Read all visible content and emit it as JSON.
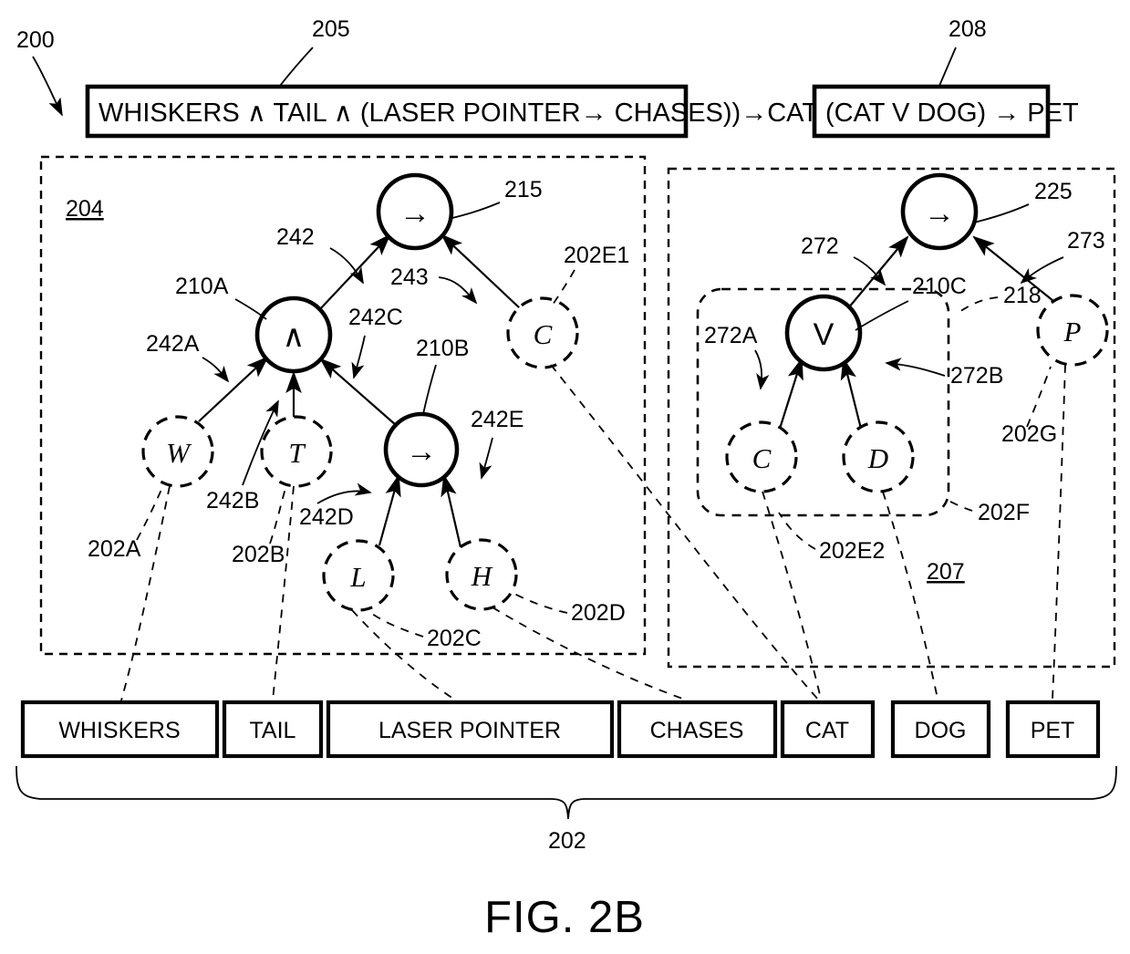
{
  "figure": {
    "caption": "FIG. 2B",
    "root_ref": "200",
    "bottom_brace_ref": "202"
  },
  "formulas": [
    {
      "id": "formula-left",
      "ref": "205",
      "text": "WHISKERS ∧ TAIL ∧ (LASER POINTER→ CHASES))→CAT"
    },
    {
      "id": "formula-right",
      "ref": "208",
      "text": "(CAT V DOG)  →  PET"
    }
  ],
  "panels": [
    {
      "id": "panel-left",
      "ref": "204"
    },
    {
      "id": "panel-right",
      "ref": "207"
    }
  ],
  "group_box": {
    "id": "group-202F",
    "ref": "202F",
    "inner_ref": "218"
  },
  "left_tree": {
    "nodes": [
      {
        "id": "n-215",
        "glyph": "→",
        "style": "solid",
        "ref": "215"
      },
      {
        "id": "n-210A",
        "glyph": "∧",
        "style": "solid",
        "ref": "210A"
      },
      {
        "id": "n-210B",
        "glyph": "→",
        "style": "solid",
        "ref": "210B"
      },
      {
        "id": "n-W",
        "glyph": "W",
        "style": "dashed",
        "ref": "202A"
      },
      {
        "id": "n-T",
        "glyph": "T",
        "style": "dashed",
        "ref": "202B"
      },
      {
        "id": "n-L",
        "glyph": "L",
        "style": "dashed",
        "ref": "202C"
      },
      {
        "id": "n-H",
        "glyph": "H",
        "style": "dashed",
        "ref": "202D"
      },
      {
        "id": "n-C1",
        "glyph": "C",
        "style": "dashed",
        "ref": "202E1"
      }
    ],
    "edges": [
      {
        "id": "e-242",
        "ref": "242"
      },
      {
        "id": "e-243",
        "ref": "243"
      },
      {
        "id": "e-242A",
        "ref": "242A"
      },
      {
        "id": "e-242B",
        "ref": "242B"
      },
      {
        "id": "e-242C",
        "ref": "242C"
      },
      {
        "id": "e-242D",
        "ref": "242D"
      },
      {
        "id": "e-242E",
        "ref": "242E"
      }
    ]
  },
  "right_tree": {
    "nodes": [
      {
        "id": "n-225",
        "glyph": "→",
        "style": "solid",
        "ref": "225"
      },
      {
        "id": "n-210C",
        "glyph": "V",
        "style": "solid",
        "ref": "210C"
      },
      {
        "id": "n-C2",
        "glyph": "C",
        "style": "dashed",
        "ref": "202E2"
      },
      {
        "id": "n-D",
        "glyph": "D",
        "style": "dashed",
        "ref": "202E2"
      },
      {
        "id": "n-P",
        "glyph": "P",
        "style": "dashed",
        "ref": "202G"
      }
    ],
    "edges": [
      {
        "id": "e-272",
        "ref": "272"
      },
      {
        "id": "e-273",
        "ref": "273"
      },
      {
        "id": "e-272A",
        "ref": "272A"
      },
      {
        "id": "e-272B",
        "ref": "272B"
      }
    ]
  },
  "terms": [
    {
      "id": "term-whiskers",
      "label": "WHISKERS"
    },
    {
      "id": "term-tail",
      "label": "TAIL"
    },
    {
      "id": "term-laser-pointer",
      "label": "LASER POINTER"
    },
    {
      "id": "term-chases",
      "label": "CHASES"
    },
    {
      "id": "term-cat",
      "label": "CAT"
    },
    {
      "id": "term-dog",
      "label": "DOG"
    },
    {
      "id": "term-pet",
      "label": "PET"
    }
  ],
  "colors": {
    "ink": "#000000",
    "paper": "#ffffff"
  }
}
